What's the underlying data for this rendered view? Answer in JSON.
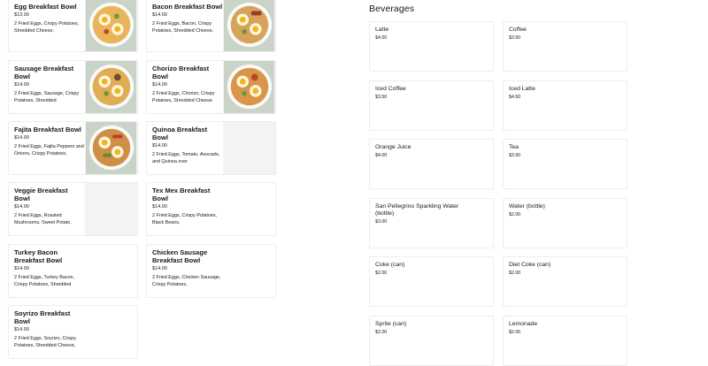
{
  "food_items": [
    {
      "name": "Egg Breakfast Bowl",
      "price": "$13.00",
      "description": "2 Fried Eggs, Crispy Potatoes, Shredded Cheese,",
      "has_image": true
    },
    {
      "name": "Bacon Breakfast Bowl",
      "price": "$14.00",
      "description": "2 Fried Eggs, Bacon, Crispy Potatoes, Shredded Cheese,",
      "has_image": true
    },
    {
      "name": "Sausage Breakfast Bowl",
      "price": "$14.00",
      "description": "2 Fried Eggs, Sausage, Crispy Potatoes, Shredded",
      "has_image": true
    },
    {
      "name": "Chorizo Breakfast Bowl",
      "price": "$14.00",
      "description": "2 Fried Eggs, Chorizo, Crispy Potatoes, Shredded Cheese",
      "has_image": true
    },
    {
      "name": "Fajita Breakfast Bowl",
      "price": "$14.00",
      "description": "2 Fried Eggs, Fajita Peppers and Onions, Crispy Potatoes,",
      "has_image": true
    },
    {
      "name": "Quinoa Breakfast Bowl",
      "price": "$14.00",
      "description": "2 Fried Eggs, Tomato, Avocado, and Quinoa over",
      "has_image": false
    },
    {
      "name": "Veggie Breakfast Bowl",
      "price": "$14.00",
      "description": "2 Fried Eggs, Roasted Mushrooms, Sweet Potato,",
      "has_image": false
    },
    {
      "name": "Tex Mex Breakfast Bowl",
      "price": "$14.00",
      "description": "2 Fried Eggs, Crispy Potatoes, Black Beans,",
      "has_image": false
    },
    {
      "name": "Turkey Bacon Breakfast Bowl",
      "price": "$14.00",
      "description": "2 Fried Eggs, Turkey Bacon, Crispy Potatoes, Shredded",
      "has_image": false
    },
    {
      "name": "Chicken Sausage Breakfast Bowl",
      "price": "$14.00",
      "description": "2 Fried Eggs, Chicken Sausage, Crispy Potatoes,",
      "has_image": false
    },
    {
      "name": "Soyrizo Breakfast Bowl",
      "price": "$14.00",
      "description": "2 Fried Eggs, Soyrizo, Crispy Potatoes, Shredded Cheese,",
      "has_image": false
    }
  ],
  "beverages_title": "Beverages",
  "beverages": [
    {
      "name": "Latte",
      "price": "$4.50"
    },
    {
      "name": "Coffee",
      "price": "$3.50"
    },
    {
      "name": "Iced Coffee",
      "price": "$3.50"
    },
    {
      "name": "Iced Latte",
      "price": "$4.50"
    },
    {
      "name": "Orange Juice",
      "price": "$4.00"
    },
    {
      "name": "Tea",
      "price": "$3.50"
    },
    {
      "name": "San Pellegrino Sparkling Water (bottle)",
      "price": "$3.00"
    },
    {
      "name": "Water (bottle)",
      "price": "$2.00"
    },
    {
      "name": "Coke (can)",
      "price": "$2.00"
    },
    {
      "name": "Diet Coke (can)",
      "price": "$2.00"
    },
    {
      "name": "Sprite (can)",
      "price": "$2.00"
    },
    {
      "name": "Lemonade",
      "price": "$2.00"
    }
  ]
}
